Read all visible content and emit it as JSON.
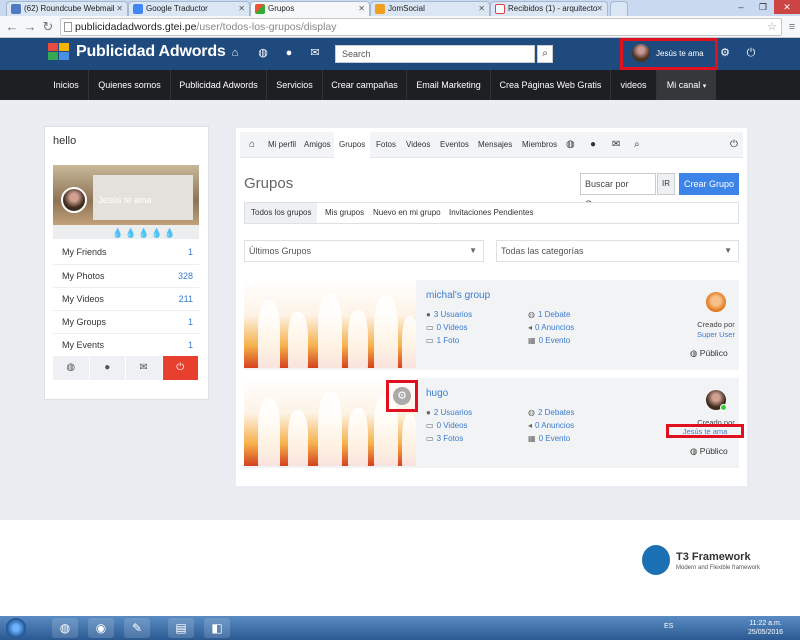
{
  "browser": {
    "tabs": [
      {
        "label": "(62) Roundcube Webmail"
      },
      {
        "label": "Google Traductor"
      },
      {
        "label": "Grupos"
      },
      {
        "label": "JomSocial"
      },
      {
        "label": "Recibidos (1) - arquitecto"
      }
    ],
    "url_domain": "publicidadadwords.gtei.pe",
    "url_path": "/user/todos-los-grupos/display"
  },
  "header": {
    "brand": "Publicidad Adwords",
    "search_placeholder": "Search",
    "user_name": "Jesús te ama"
  },
  "mainnav": [
    "Inicios",
    "Quienes somos",
    "Publicidad Adwords",
    "Servicios",
    "Crear campañas",
    "Email Marketing",
    "Crea Páginas Web Gratis",
    "videos",
    "Mi canal"
  ],
  "left": {
    "title": "hello",
    "cover_name": "Jesús te ama",
    "rows": [
      {
        "label": "My Friends",
        "count": "1"
      },
      {
        "label": "My Photos",
        "count": "328"
      },
      {
        "label": "My Videos",
        "count": "211"
      },
      {
        "label": "My Groups",
        "count": "1"
      },
      {
        "label": "My Events",
        "count": "1"
      }
    ]
  },
  "subnav": [
    "Mi perfil",
    "Amigos",
    "Grupos",
    "Fotos",
    "Videos",
    "Eventos",
    "Mensajes",
    "Miembros"
  ],
  "groups_page": {
    "title": "Grupos",
    "search_value": "Buscar por Grupo",
    "ir": "IR",
    "create": "Crear Grupo",
    "filter_tabs": [
      "Todos los grupos",
      "Mis grupos",
      "Nuevo en mi grupo",
      "Invitaciones Pendientes"
    ],
    "sort_select": "Últimos Grupos",
    "category_select": "Todas las categorías"
  },
  "groups": [
    {
      "name": "michal's group",
      "users": "3 Usuarios",
      "videos": "0 Videos",
      "photos": "1 Foto",
      "discussions": "1 Debate",
      "announcements": "0 Anuncios",
      "events": "0 Evento",
      "created_by_label": "Creado por",
      "creator": "Super User",
      "privacy": "Público"
    },
    {
      "name": "hugo",
      "users": "2 Usuarios",
      "videos": "0 Videos",
      "photos": "3 Fotos",
      "discussions": "2 Debates",
      "announcements": "0 Anuncios",
      "events": "0 Evento",
      "created_by_label": "Creado por",
      "creator": "Jesús te ama",
      "privacy": "Público"
    }
  ],
  "footer": {
    "brand": "T3 Framework",
    "tagline": "Modern and Flexible framework"
  },
  "taskbar": {
    "lang": "ES",
    "time": "11:22 a.m.",
    "date": "25/05/2016"
  },
  "colors": {
    "header_bg": "#1e4a7e",
    "nav_bg": "#1e1f22",
    "link": "#3b7ccf",
    "primary_button": "#3d84e8",
    "highlight_box": "#e0101e"
  }
}
